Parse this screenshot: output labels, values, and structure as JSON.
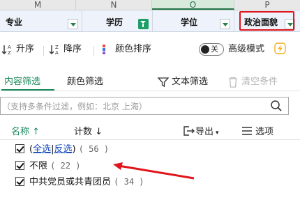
{
  "columns": {
    "letters": [
      "M",
      "N",
      "O",
      "P"
    ],
    "headers": [
      {
        "label": "专业"
      },
      {
        "label": "学历"
      },
      {
        "label": "学位"
      },
      {
        "label": "政治面貌"
      }
    ]
  },
  "sort": {
    "asc_label": "升序",
    "desc_label": "降序",
    "color_label": "颜色排序",
    "toggle_state": "关",
    "advanced_label": "高级模式"
  },
  "tabs": {
    "content": "内容筛选",
    "color": "颜色筛选",
    "text_filter": "文本筛选",
    "clear": "清空条件"
  },
  "search": {
    "placeholder": "（支持多条件过滤，例如：北京 上海）"
  },
  "list_header": {
    "name": "名称",
    "count": "计数",
    "export": "导出",
    "options": "选项"
  },
  "items": {
    "select_all": "全选",
    "invert": "反选",
    "all_count": "( 56 )",
    "row1_label": "不限",
    "row1_count": "( 22 )",
    "row2_label": "中共党员或共青团员",
    "row2_count": "( 34 )"
  },
  "colors": {
    "accent": "#1a8a5a",
    "highlight_border": "#e0141b",
    "arrow": "#e0141b"
  }
}
